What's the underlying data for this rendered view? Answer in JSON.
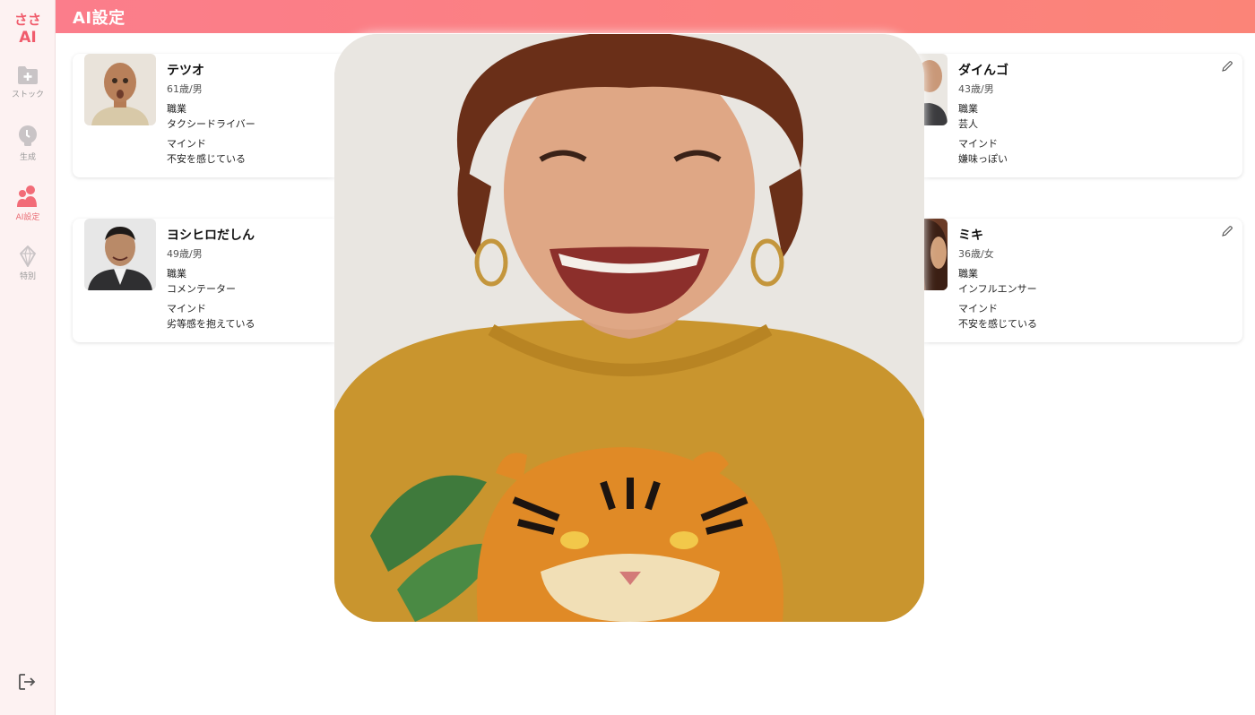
{
  "app": {
    "logo_text": "ささAI",
    "brand_color": "#fb7d8b",
    "header_title": "AI設定"
  },
  "sidebar": {
    "items": [
      {
        "label": "ストック",
        "icon": "folder-plus-icon",
        "active": false
      },
      {
        "label": "生成",
        "icon": "lightbulb-icon",
        "active": false
      },
      {
        "label": "AI設定",
        "icon": "users-icon",
        "active": true
      },
      {
        "label": "特別",
        "icon": "diamond-icon",
        "active": false
      }
    ],
    "logout_icon": "logout-icon"
  },
  "cards": [
    {
      "name": "テツオ",
      "meta": "61歳/男",
      "job_label": "職業",
      "job": "タクシードライバー",
      "mind_label": "マインド",
      "mind": "不安を感じている"
    },
    {
      "name": "ダイんゴ",
      "meta": "43歳/男",
      "job_label": "職業",
      "job": "芸人",
      "mind_label": "マインド",
      "mind": "嫌味っぽい"
    },
    {
      "name": "ヨシヒロだしん",
      "meta": "49歳/男",
      "job_label": "職業",
      "job": "コメンテーター",
      "mind_label": "マインド",
      "mind": "劣等感を抱えている"
    },
    {
      "name": "ミキ",
      "meta": "36歳/女",
      "job_label": "職業",
      "job": "インフルエンサー",
      "mind_label": "マインド",
      "mind": "不安を感じている"
    }
  ]
}
